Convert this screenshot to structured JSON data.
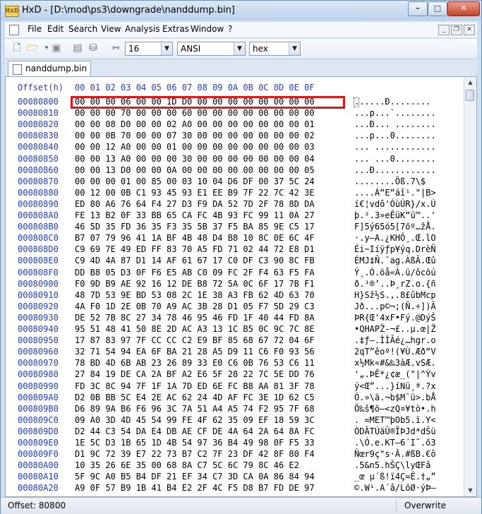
{
  "window": {
    "title": "HxD - [D:\\mod\\ps3\\downgrade\\nanddump.bin]",
    "app_badge": "HxD"
  },
  "menu": [
    "File",
    "Edit",
    "Search",
    "View",
    "Analysis",
    "Extras",
    "Window",
    "?"
  ],
  "toolbar": {
    "bytes_per_row": "16",
    "charset": "ANSI",
    "display_mode": "hex"
  },
  "tab": {
    "label": "nanddump.bin"
  },
  "editor": {
    "offset_header": "Offset(h)",
    "hex_header": "00 01 02 03 04 05 06 07 08 09 0A 0B 0C 0D 0E 0F",
    "rows": [
      {
        "off": "00080800",
        "hex": "00 00 00 06 00 00 1D D0 00 00 00 00 00 00 00 00",
        "asc": "......Ð........"
      },
      {
        "off": "00080810",
        "hex": "00 00 00 70 00 00 00 60 00 00 00 00 00 00 00 00",
        "asc": "...p...`........"
      },
      {
        "off": "00080820",
        "hex": "00 00 08 D0 00 00 02 A0 00 00 00 00 00 00 00 01",
        "asc": "...Ð... ........"
      },
      {
        "off": "00080830",
        "hex": "00 00 0B 70 00 00 07 30 00 00 00 00 00 00 00 02",
        "asc": "...p...0........"
      },
      {
        "off": "00080840",
        "hex": "00 00 12 A0 00 00 01 00 00 00 00 00 00 00 00 03",
        "asc": "... ............"
      },
      {
        "off": "00080850",
        "hex": "00 00 13 A0 00 00 00 30 00 00 00 00 00 00 00 04",
        "asc": "... ...0........"
      },
      {
        "off": "00080860",
        "hex": "00 00 13 D0 00 00 0A 00 00 00 00 00 00 00 00 05",
        "asc": "...Ð............"
      },
      {
        "off": "00080870",
        "hex": "00 00 00 01 00 85 00 03 10 04 D6 DF 00 37 5C 24",
        "asc": "........Öß.7\\$"
      },
      {
        "off": "00080880",
        "hex": "00 12 00 0B C1 93 45 93 E1 EE B9 7F 22 7C 42 3E",
        "asc": "....Á“E“áî¹.\"|B>"
      },
      {
        "off": "00080890",
        "hex": "ED 80 A6 76 64 F4 27 D3 F9 DA 52 7D 2F 78 8D DA",
        "asc": "í€¦vdô'ÓùÚR}/x.Ú"
      },
      {
        "off": "000808A0",
        "hex": "FE 13 B2 0F 33 BB 65 CA FC 4B 93 FC 99 11 0A 27",
        "asc": "þ.².3»eÊüK“ü™..'"
      },
      {
        "off": "000808B0",
        "hex": "46 5D 35 FD 36 35 F3 35 5B 37 F5 BA 85 9E C5 17",
        "asc": "F]5ý65ó5[7õº…žÅ."
      },
      {
        "off": "000808C0",
        "hex": "B7 07 79 96 41 1A BF 4B 48 D4 B8 10 8C 0E 6C 4F",
        "asc": "·.y–A.¿KHÔ¸.Œ.lO"
      },
      {
        "off": "000808D0",
        "hex": "C9 69 7E 49 ED FF 83 70 A5 FD 71 02 44 72 E8 D1",
        "asc": "Éi~Iíÿƒp¥ýq.DrèÑ"
      },
      {
        "off": "000808E0",
        "hex": "C9 4D 4A 87 D1 14 AF 61 67 17 C0 DF C3 90 8C FB",
        "asc": "ÉMJ‡Ñ.¯ag.ÀßÃ.Œû"
      },
      {
        "off": "000808F0",
        "hex": "DD B8 05 D3 0F F6 E5 AB C0 09 FC 2F F4 63 F5 FA",
        "asc": "Ý¸.Ó.öå«À.ü/ôcõú"
      },
      {
        "off": "00080900",
        "hex": "F0 9D B9 AE 92 16 12 DE B8 72 5A 0C 6F 17 7B F1",
        "asc": "ð.¹®’..Þ¸rZ.o.{ñ"
      },
      {
        "off": "00080910",
        "hex": "48 7D 53 9E BD 53 08 2C 1E 38 A3 FB 62 4D 63 70",
        "asc": "H}Sž½S.,.8£ûbMcp"
      },
      {
        "off": "00080920",
        "hex": "4A F0 1D 2E 0B 70 A9 AC 3B 28 D1 05 F7 5D 29 C3",
        "asc": "Jð...p©¬;(Ñ.÷])Ã"
      },
      {
        "off": "00080930",
        "hex": "DE 52 7B 8C 27 34 78 46 95 46 FD 1F 40 44 FD 8A",
        "asc": "ÞR{Œ'4xF•Fý.@DýŠ"
      },
      {
        "off": "00080940",
        "hex": "95 51 48 41 50 8E 2D AC A3 13 1C B5 0C 9C 7C 8E",
        "asc": "•QHAPŽ-¬£..µ.œ|Ž"
      },
      {
        "off": "00080950",
        "hex": "17 87 83 97 7F CC CC C2 E9 BF 85 68 67 72 04 6F",
        "asc": ".‡ƒ—.ÌÌÂé¿…hgr.o"
      },
      {
        "off": "00080960",
        "hex": "32 71 54 94 EA 6F BA 21 28 A5 D9 11 C6 F0 93 56",
        "asc": "2qT”êoº!(¥Ù.Æð“V"
      },
      {
        "off": "00080970",
        "hex": "78 BD 4D 6B AB 23 26 89 33 E0 C6 0B 76 53 C6 11",
        "asc": "x½Mk«#&‰3àÆ.vSÆ."
      },
      {
        "off": "00080980",
        "hex": "27 84 19 DE CA 2A BF A2 E6 5F 28 22 7C 5E DD 76",
        "asc": "'„.ÞÊ*¿¢æ_(\"|^Ýv"
      },
      {
        "off": "00080990",
        "hex": "FD 3C 8C 94 7F 1F 1A 7D ED 6E FC B8 AA 81 3F 78",
        "asc": "ý<Œ”...}íNü¸ª.?x"
      },
      {
        "off": "000809A0",
        "hex": "D2 0B BB 5C E4 2E AC 62 24 4D AF FC 3E 1D 62 C5",
        "asc": "Ò.»\\ä.¬b$M¯ü>.bÅ"
      },
      {
        "off": "000809B0",
        "hex": "D6 89 9A B6 F6 96 3C 7A 51 A4 A5 74 F2 95 7F 68",
        "asc": "Ö‰š¶ö–<zQ¤¥tò•.h"
      },
      {
        "off": "000809C0",
        "hex": "09 A0 3D 4D 45 54 99 FE 4F 62 35 09 EF 18 59 3C",
        "asc": ". =MET™þOb5.ï.Y<"
      },
      {
        "off": "000809D0",
        "hex": "D2 44 C3 54 DA E4 DB AE CF DE 4A 64 2A 64 8A FC",
        "asc": "ÒDÃTÚäÛ®ÏÞJd*dŠü"
      },
      {
        "off": "000809E0",
        "hex": "1E 5C D3 1B 65 1D 4B 54 97 36 B4 49 98 0F F5 33",
        "asc": ".\\Ó.e.KT—6´I˜.õ3"
      },
      {
        "off": "000809F0",
        "hex": "D1 9C 72 39 E7 22 73 B7 C2 7F 23 DF 42 8F 80 F4",
        "asc": "Ñœr9ç\"s·Â.#ßB.€ô"
      },
      {
        "off": "00080A00",
        "hex": "10 35 26 6E 35 00 68 8A C7 5C 6C 79 8C 46 E2",
        "asc": ".5&n5.hŠÇ\\lyŒFâ"
      },
      {
        "off": "00080A10",
        "hex": "5F 9C A0 B5 B4 DF 21 EF 34 C7 3D CA 0A 86 84 94",
        "asc": "_œ µ´ß!ï4Ç=Ê.†„”"
      },
      {
        "off": "00080A20",
        "hex": "A9 0F 57 B9 1B 41 B4 E2 2F 4C F5 D8 B7 FD DE 97",
        "asc": "©.W¹.A´â/LõØ·ýÞ—"
      }
    ]
  },
  "status": {
    "offset_label": "Offset: 80800",
    "mode": "Overwrite"
  },
  "colors": {
    "offset_blue": "#2040c0",
    "highlight_red": "#e0181a"
  }
}
